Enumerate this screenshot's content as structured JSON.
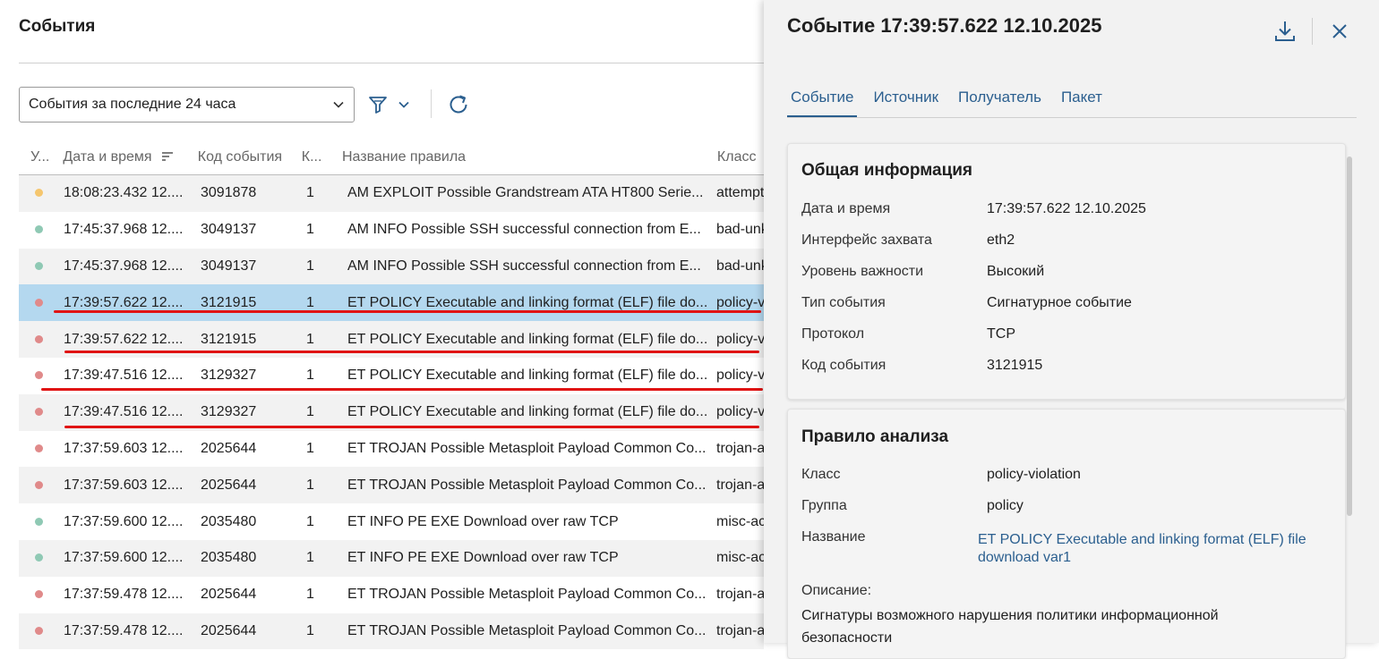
{
  "page": {
    "title": "События"
  },
  "toolbar": {
    "period_value": "События за последние 24 часа"
  },
  "table": {
    "columns": [
      "У...",
      "Дата и время",
      "Код события",
      "К...",
      "Название правила",
      "Класс"
    ],
    "rows": [
      {
        "level_color": "#f5c66e",
        "datetime": "18:08:23.432 12....",
        "code": "3091878",
        "k": "1",
        "name": "AM EXPLOIT Possible Grandstream ATA HT800 Serie...",
        "cls": "attempt"
      },
      {
        "level_color": "#8fc9b4",
        "datetime": "17:45:37.968 12....",
        "code": "3049137",
        "k": "1",
        "name": "AM INFO Possible SSH successful connection from E...",
        "cls": "bad-unk"
      },
      {
        "level_color": "#8fc9b4",
        "datetime": "17:45:37.968 12....",
        "code": "3049137",
        "k": "1",
        "name": "AM INFO Possible SSH successful connection from E...",
        "cls": "bad-unk"
      },
      {
        "level_color": "#e08a8a",
        "datetime": "17:39:57.622 12....",
        "code": "3121915",
        "k": "1",
        "name": "ET POLICY Executable and linking format (ELF) file do...",
        "cls": "policy-v"
      },
      {
        "level_color": "#e08a8a",
        "datetime": "17:39:57.622 12....",
        "code": "3121915",
        "k": "1",
        "name": "ET POLICY Executable and linking format (ELF) file do...",
        "cls": "policy-v"
      },
      {
        "level_color": "#e08a8a",
        "datetime": "17:39:47.516 12....",
        "code": "3129327",
        "k": "1",
        "name": "ET POLICY Executable and linking format (ELF) file do...",
        "cls": "policy-v"
      },
      {
        "level_color": "#e08a8a",
        "datetime": "17:39:47.516 12....",
        "code": "3129327",
        "k": "1",
        "name": "ET POLICY Executable and linking format (ELF) file do...",
        "cls": "policy-v"
      },
      {
        "level_color": "#e08a8a",
        "datetime": "17:37:59.603 12....",
        "code": "2025644",
        "k": "1",
        "name": "ET TROJAN Possible Metasploit Payload Common Co...",
        "cls": "trojan-a"
      },
      {
        "level_color": "#e08a8a",
        "datetime": "17:37:59.603 12....",
        "code": "2025644",
        "k": "1",
        "name": "ET TROJAN Possible Metasploit Payload Common Co...",
        "cls": "trojan-a"
      },
      {
        "level_color": "#8fc9b4",
        "datetime": "17:37:59.600 12....",
        "code": "2035480",
        "k": "1",
        "name": "ET INFO PE EXE Download over raw TCP",
        "cls": "misc-ac"
      },
      {
        "level_color": "#8fc9b4",
        "datetime": "17:37:59.600 12....",
        "code": "2035480",
        "k": "1",
        "name": "ET INFO PE EXE Download over raw TCP",
        "cls": "misc-ac"
      },
      {
        "level_color": "#e08a8a",
        "datetime": "17:37:59.478 12....",
        "code": "2025644",
        "k": "1",
        "name": "ET TROJAN Possible Metasploit Payload Common Co...",
        "cls": "trojan-a"
      },
      {
        "level_color": "#e08a8a",
        "datetime": "17:37:59.478 12....",
        "code": "2025644",
        "k": "1",
        "name": "ET TROJAN Possible Metasploit Payload Common Co...",
        "cls": "trojan-a"
      }
    ],
    "selected_row": 3,
    "underlined_rows": [
      3,
      4,
      5,
      6
    ]
  },
  "drawer": {
    "title": "Событие 17:39:57.622 12.10.2025",
    "tabs": [
      "Событие",
      "Источник",
      "Получатель",
      "Пакет"
    ],
    "active_tab": 0,
    "general": {
      "title": "Общая информация",
      "fields": [
        {
          "key": "Дата и время",
          "value": "17:39:57.622 12.10.2025"
        },
        {
          "key": "Интерфейс захвата",
          "value": "eth2"
        },
        {
          "key": "Уровень важности",
          "value": "Высокий"
        },
        {
          "key": "Тип события",
          "value": "Сигнатурное событие"
        },
        {
          "key": "Протокол",
          "value": "TCP"
        },
        {
          "key": "Код события",
          "value": "3121915"
        }
      ]
    },
    "rule": {
      "title": "Правило анализа",
      "fields": [
        {
          "key": "Класс",
          "value": "policy-violation"
        },
        {
          "key": "Группа",
          "value": "policy"
        }
      ],
      "name_key": "Название",
      "name_link": "ET POLICY Executable and linking format (ELF) file download var1",
      "desc_label": "Описание:",
      "desc_text": "Сигнатуры возможного нарушения политики информационной безопасности"
    }
  },
  "colors": {
    "accent": "#2b5f8f",
    "selected_row": "#b4d8ef",
    "annotation": "#e01414"
  },
  "icons": [
    "chevron-down-icon",
    "filter-icon",
    "refresh-icon",
    "sort-icon",
    "download-icon",
    "close-icon"
  ]
}
